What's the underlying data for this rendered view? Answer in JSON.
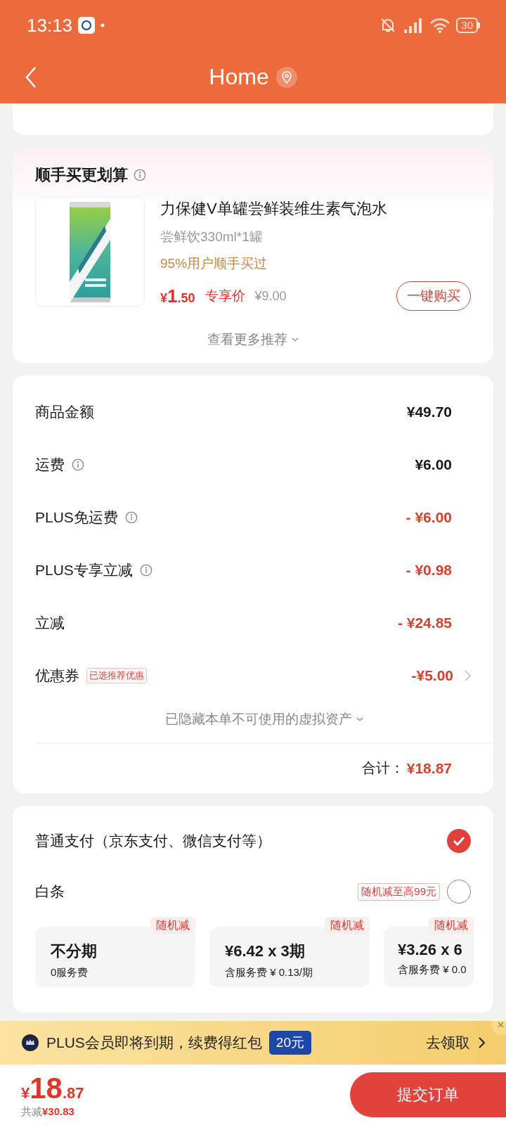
{
  "status_bar": {
    "time": "13:13",
    "battery": "30"
  },
  "nav": {
    "title": "Home"
  },
  "bundle": {
    "title": "顺手买更划算",
    "product": {
      "name": "力保健V单罐尝鲜装维生素气泡水",
      "spec": "尝鲜饮330ml*1罐",
      "social_proof": "95%用户顺手买过",
      "currency": "¥",
      "price_int": "1",
      "price_dec": ".50",
      "price_tag": "专享价",
      "original_price": "¥9.00",
      "buy_button": "一键购买"
    },
    "more_link": "查看更多推荐"
  },
  "summary": {
    "rows": [
      {
        "label": "商品金额",
        "info": false,
        "kind": "normal",
        "value": "¥49.70",
        "chevron": false
      },
      {
        "label": "运费",
        "info": true,
        "kind": "normal",
        "value": "¥6.00",
        "chevron": false
      },
      {
        "label": "PLUS免运费",
        "info": true,
        "kind": "discount",
        "value": "- ¥6.00",
        "chevron": false
      },
      {
        "label": "PLUS专享立减",
        "info": true,
        "kind": "discount",
        "value": "- ¥0.98",
        "chevron": false
      },
      {
        "label": "立减",
        "info": false,
        "kind": "discount",
        "value": "- ¥24.85",
        "chevron": false
      },
      {
        "label": "优惠券",
        "info": false,
        "tag": "已选推荐优惠",
        "kind": "discount",
        "value": "-¥5.00",
        "chevron": true
      }
    ],
    "hidden_note": "已隐藏本单不可使用的虚拟资产",
    "total_label": "合计：",
    "total_value": "¥18.87"
  },
  "payment": {
    "options": [
      {
        "label": "普通支付（京东支付、微信支付等）",
        "selected": true
      },
      {
        "label": "白条",
        "tag": "随机减至高99元",
        "selected": false
      }
    ],
    "installments": [
      {
        "badge": "随机减",
        "title": "不分期",
        "subtitle": "0服务费"
      },
      {
        "badge": "随机减",
        "title": "¥6.42 x 3期",
        "subtitle": "含服务费 ¥ 0.13/期"
      },
      {
        "badge": "随机减",
        "title": "¥3.26 x 6",
        "subtitle": "含服务费 ¥ 0.0"
      }
    ]
  },
  "banner": {
    "text": "PLUS会员即将到期，续费得红包",
    "badge": "20元",
    "action": "去领取"
  },
  "footer": {
    "currency": "¥",
    "price_int": "18",
    "price_dec": ".87",
    "saved_label": "共减",
    "saved_value": "¥30.83",
    "submit": "提交订单"
  }
}
